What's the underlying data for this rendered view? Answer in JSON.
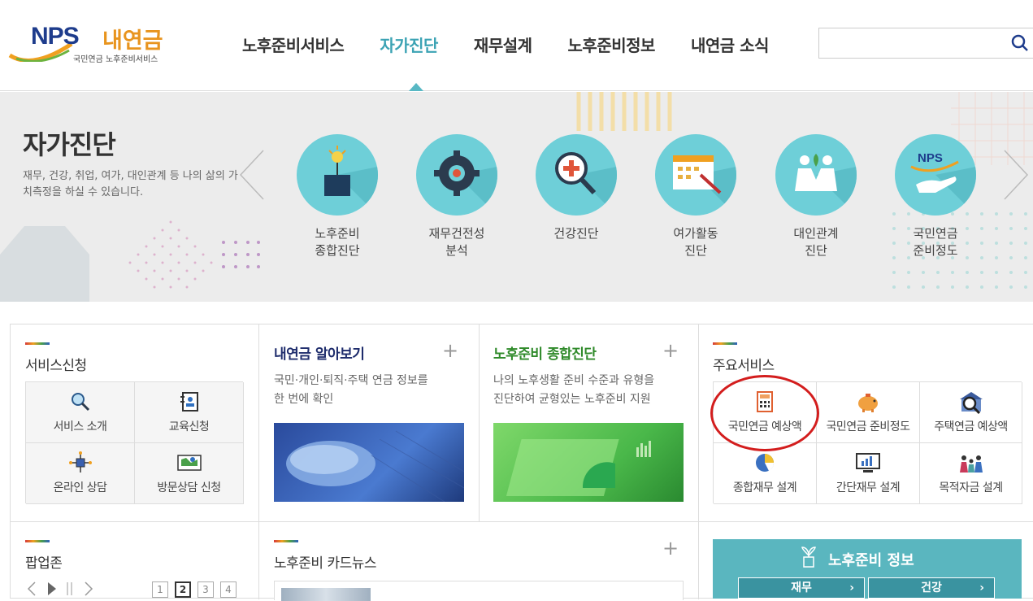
{
  "logo": {
    "nps": "NPS",
    "my": "내연금",
    "sub": "국민연금 노후준비서비스"
  },
  "nav": {
    "items": [
      "노후준비서비스",
      "자가진단",
      "재무설계",
      "노후준비정보",
      "내연금 소식"
    ],
    "active_index": 1
  },
  "search": {
    "placeholder": "",
    "value": ""
  },
  "banner": {
    "title": "자가진단",
    "desc": "재무, 건강, 취업, 여가, 대인관계 등 나의 삶의 가치측정을 하실 수 있습니다.",
    "items": [
      {
        "label": "노후준비\n종합진단",
        "icon": "plant-pot-icon"
      },
      {
        "label": "재무건전성\n분석",
        "icon": "gear-icon"
      },
      {
        "label": "건강진단",
        "icon": "medical-magnifier-icon"
      },
      {
        "label": "여가활동\n진단",
        "icon": "calendar-icon"
      },
      {
        "label": "대인관계\n진단",
        "icon": "people-icon"
      },
      {
        "label": "국민연금\n준비정도",
        "icon": "nps-hand-icon"
      }
    ]
  },
  "service_apply": {
    "title": "서비스신청",
    "items": [
      {
        "label": "서비스 소개",
        "icon": "magnifier-icon"
      },
      {
        "label": "교육신청",
        "icon": "address-book-icon"
      },
      {
        "label": "온라인 상담",
        "icon": "network-icon"
      },
      {
        "label": "방문상담 신청",
        "icon": "map-icon"
      }
    ]
  },
  "pension_view": {
    "title": "내연금 알아보기",
    "plus": "+",
    "desc": "국민·개인·퇴직·주택 연금 정보를\n한 번에 확인"
  },
  "diagnosis": {
    "title": "노후준비 종합진단",
    "plus": "+",
    "desc": "나의 노후생활 준비 수준과 유형을\n진단하여 균형있는 노후준비 지원"
  },
  "main_services": {
    "title": "주요서비스",
    "items": [
      {
        "label": "국민연금 예상액",
        "icon": "calculator-icon"
      },
      {
        "label": "국민연금 준비정도",
        "icon": "piggy-bank-icon"
      },
      {
        "label": "주택연금 예상액",
        "icon": "house-search-icon"
      },
      {
        "label": "종합재무 설계",
        "icon": "pie-chart-icon"
      },
      {
        "label": "간단재무 설계",
        "icon": "monitor-chart-icon"
      },
      {
        "label": "목적자금 설계",
        "icon": "family-icon"
      }
    ]
  },
  "popup_zone": {
    "title": "팝업존",
    "pages": [
      "1",
      "2",
      "3",
      "4"
    ],
    "active_page": "2"
  },
  "card_news": {
    "title": "노후준비 카드뉴스",
    "plus": "+"
  },
  "info": {
    "title": "노후준비 정보",
    "buttons": [
      {
        "label": "재무"
      },
      {
        "label": "건강"
      }
    ]
  },
  "colors": {
    "accent": "#3ca3b4",
    "nav_text": "#333333",
    "banner_circle": "#6ecfd8",
    "highlight": "#d31d1d",
    "info_bg": "#5ab6bf"
  }
}
